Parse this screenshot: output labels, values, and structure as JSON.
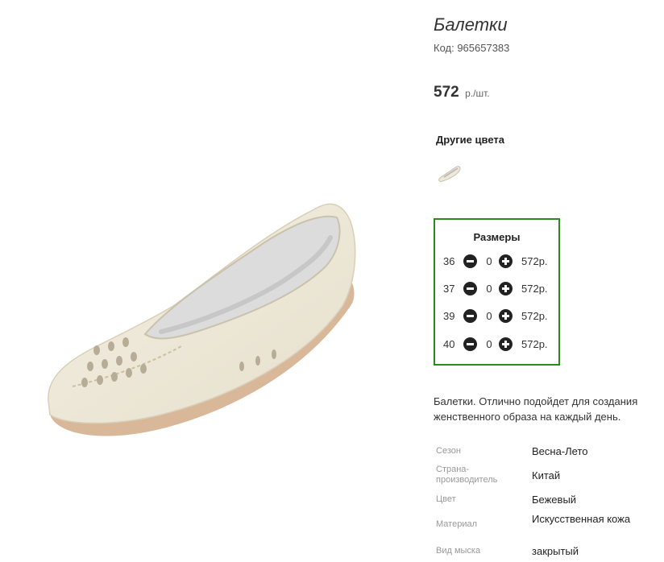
{
  "product": {
    "title": "Балетки",
    "sku": "Код: 965657383",
    "price_value": "572",
    "price_unit": "р./шт."
  },
  "other_colors": {
    "heading": "Другие цвета",
    "swatch_icon": "shoe-thumbnail"
  },
  "sizes": {
    "heading": "Размеры",
    "border_color": "#2a8a1e",
    "rows": [
      {
        "size": "36",
        "qty": "0",
        "price": "572р."
      },
      {
        "size": "37",
        "qty": "0",
        "price": "572р."
      },
      {
        "size": "39",
        "qty": "0",
        "price": "572р."
      },
      {
        "size": "40",
        "qty": "0",
        "price": "572р."
      }
    ]
  },
  "description": "Балетки. Отлично подойдет для создания женственного образа на каждый день.",
  "specs": [
    {
      "label": "Сезон",
      "value": "Весна-Лето"
    },
    {
      "label": "Страна-производитель",
      "value": "Китай"
    },
    {
      "label": "Цвет",
      "value": "Бежевый"
    },
    {
      "label": "Материал",
      "value": "Искусственная кожа"
    },
    {
      "label": "Вид мыска",
      "value": "закрытый"
    }
  ]
}
